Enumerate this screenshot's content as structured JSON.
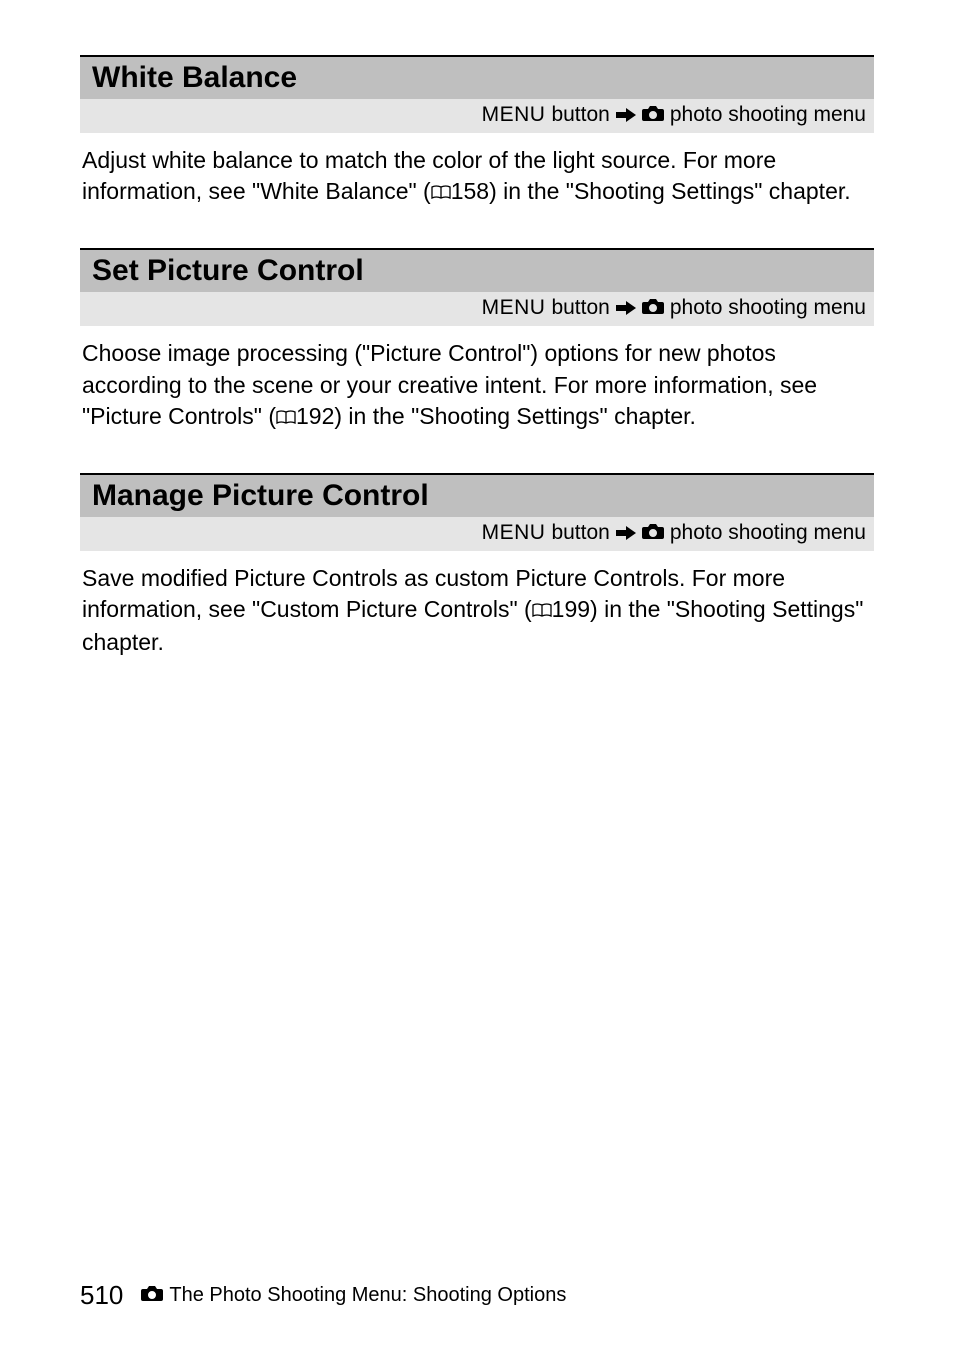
{
  "sections": [
    {
      "title": "White Balance",
      "breadcrumb": {
        "menu": "MENU",
        "button": " button",
        "target": " photo shooting menu"
      },
      "body_pre": "Adjust white balance to match the color of the light source. For more information, see \"White Balance\" (",
      "body_ref": "158) in the \"Shooting Settings\" chapter."
    },
    {
      "title": "Set Picture Control",
      "breadcrumb": {
        "menu": "MENU",
        "button": " button",
        "target": " photo shooting menu"
      },
      "body_pre": "Choose image processing (\"Picture Control\") options for new photos according to the scene or your creative intent. For more information, see \"Picture Controls\" (",
      "body_ref": "192) in the \"Shooting Settings\" chapter."
    },
    {
      "title": "Manage Picture Control",
      "breadcrumb": {
        "menu": "MENU",
        "button": " button",
        "target": " photo shooting menu"
      },
      "body_pre": "Save modified Picture Controls as custom Picture Controls. For more information, see \"Custom Picture Controls\" (",
      "body_ref": "199) in the \"Shooting Settings\" chapter."
    }
  ],
  "footer": {
    "page": "510",
    "text": "The Photo Shooting Menu: Shooting Options"
  }
}
